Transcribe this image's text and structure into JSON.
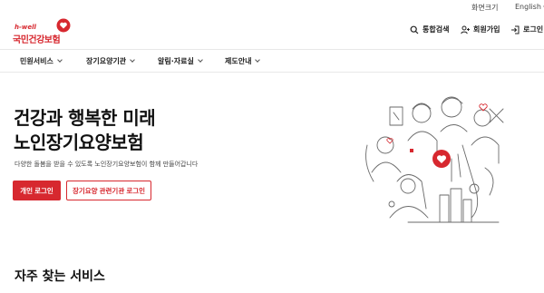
{
  "util": {
    "zoom_label": "화면크기",
    "lang_label": "English"
  },
  "logo": {
    "small_text": "h-well",
    "main_text": "국민건강보험"
  },
  "header_actions": {
    "search": "통합검색",
    "join": "회원가입",
    "login": "로그인"
  },
  "gnb": [
    {
      "label": "민원서비스"
    },
    {
      "label": "장기요양기관"
    },
    {
      "label": "알림·자료실"
    },
    {
      "label": "제도안내"
    }
  ],
  "hero": {
    "title_line1": "건강과 행복한 미래",
    "title_line2": "노인장기요양보험",
    "description": "다양한 돌봄을 받을 수 있도록 노인장기요양보험이 함께 만들어갑니다",
    "primary_button": "개인 로그인",
    "secondary_button": "장기요양 관련기관 로그인"
  },
  "section": {
    "title": "자주 찾는 서비스"
  },
  "colors": {
    "brand": "#d7282f",
    "text": "#222222"
  },
  "icons": [
    "chevron-down-icon",
    "heart-icon",
    "search-icon",
    "user-plus-icon",
    "login-icon"
  ]
}
